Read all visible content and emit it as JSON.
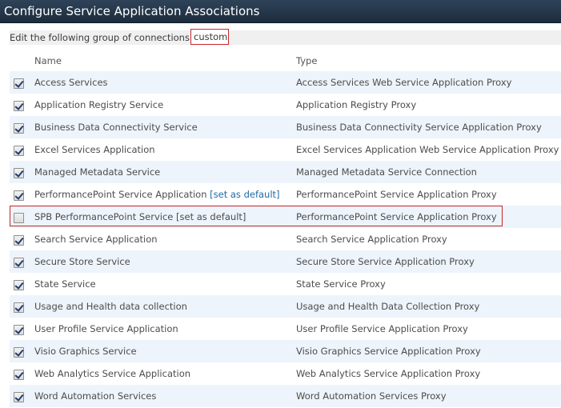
{
  "window": {
    "title": "Configure Service Application Associations"
  },
  "group": {
    "label": "Edit the following group of connections:",
    "value": "custom"
  },
  "columns": {
    "name": "Name",
    "type": "Type"
  },
  "rows": [
    {
      "checked": true,
      "name": "Access Services",
      "link": "",
      "type": "Access Services Web Service Application Proxy"
    },
    {
      "checked": true,
      "name": "Application Registry Service",
      "link": "",
      "type": "Application Registry Proxy"
    },
    {
      "checked": true,
      "name": "Business Data Connectivity Service",
      "link": "",
      "type": "Business Data Connectivity Service Application Proxy"
    },
    {
      "checked": true,
      "name": "Excel Services Application",
      "link": "",
      "type": "Excel Services Application Web Service Application Proxy"
    },
    {
      "checked": true,
      "name": "Managed Metadata Service",
      "link": "",
      "type": "Managed Metadata Service Connection"
    },
    {
      "checked": true,
      "name": "PerformancePoint Service Application",
      "link": "[set as default]",
      "type": "PerformancePoint Service Application Proxy"
    },
    {
      "checked": false,
      "name": "SPB PerformancePoint Service [set as default]",
      "link": "",
      "type": "PerformancePoint Service Application Proxy"
    },
    {
      "checked": true,
      "name": "Search Service Application",
      "link": "",
      "type": "Search Service Application Proxy"
    },
    {
      "checked": true,
      "name": "Secure Store Service",
      "link": "",
      "type": "Secure Store Service Application Proxy"
    },
    {
      "checked": true,
      "name": "State Service",
      "link": "",
      "type": "State Service Proxy"
    },
    {
      "checked": true,
      "name": "Usage and Health data collection",
      "link": "",
      "type": "Usage and Health Data Collection Proxy"
    },
    {
      "checked": true,
      "name": "User Profile Service Application",
      "link": "",
      "type": "User Profile Service Application Proxy"
    },
    {
      "checked": true,
      "name": "Visio Graphics Service",
      "link": "",
      "type": "Visio Graphics Service Application Proxy"
    },
    {
      "checked": true,
      "name": "Web Analytics Service Application",
      "link": "",
      "type": "Web Analytics Service Application Proxy"
    },
    {
      "checked": true,
      "name": "Word Automation Services",
      "link": "",
      "type": "Word Automation Services Proxy"
    }
  ]
}
